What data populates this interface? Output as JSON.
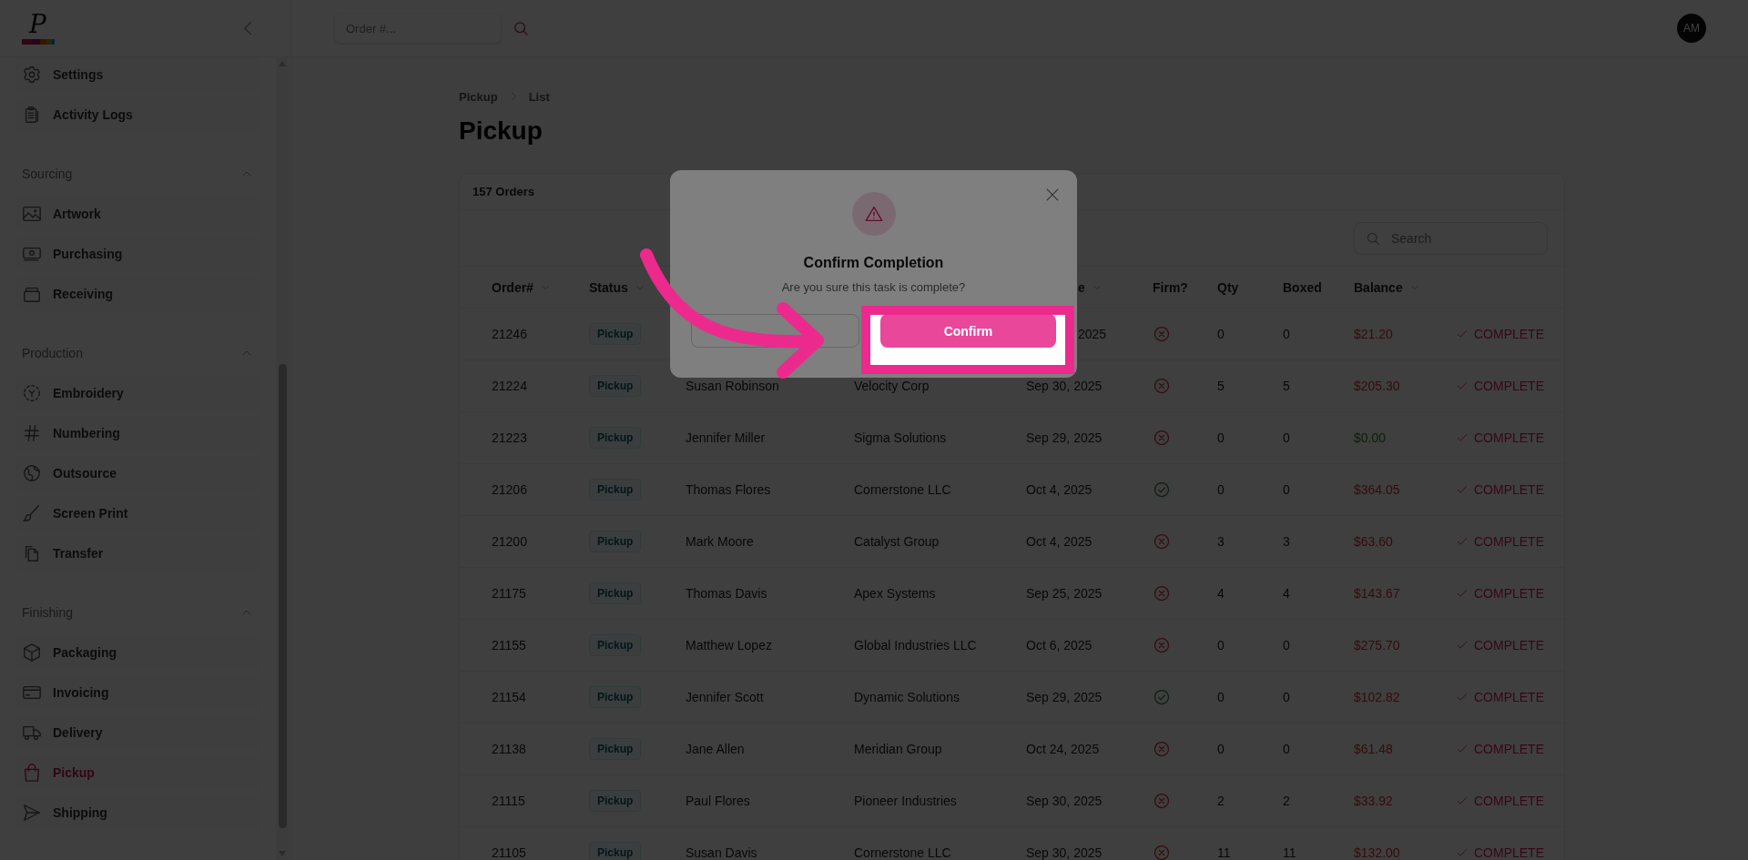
{
  "sidebar": {
    "logo": "P",
    "sections": [
      {
        "items": [
          {
            "label": "Settings",
            "selected": false
          },
          {
            "label": "Activity Logs",
            "selected": false
          }
        ]
      },
      {
        "title": "Sourcing",
        "expanded": true,
        "items": [
          {
            "label": "Artwork",
            "selected": false
          },
          {
            "label": "Purchasing",
            "selected": false
          },
          {
            "label": "Receiving",
            "selected": false
          }
        ]
      },
      {
        "title": "Production",
        "expanded": true,
        "items": [
          {
            "label": "Embroidery",
            "selected": false
          },
          {
            "label": "Numbering",
            "selected": false
          },
          {
            "label": "Outsource",
            "selected": false
          },
          {
            "label": "Screen Print",
            "selected": false
          },
          {
            "label": "Transfer",
            "selected": false
          }
        ]
      },
      {
        "title": "Finishing",
        "expanded": true,
        "items": [
          {
            "label": "Packaging",
            "selected": false
          },
          {
            "label": "Invoicing",
            "selected": false
          },
          {
            "label": "Delivery",
            "selected": false
          },
          {
            "label": "Pickup",
            "selected": true
          },
          {
            "label": "Shipping",
            "selected": false
          }
        ]
      }
    ]
  },
  "topbar": {
    "search": {
      "placeholder": "Order #..."
    },
    "avatar": "AM"
  },
  "breadcrumb": [
    "Pickup",
    "List"
  ],
  "title": "Pickup",
  "orders": {
    "count": "157 Orders",
    "search": {
      "placeholder": "Search"
    },
    "columns": [
      {
        "label": "Order#",
        "sortable": true
      },
      {
        "label": "Status",
        "sortable": true
      },
      {
        "label": "e",
        "sortable": true
      },
      {
        "label": "Firm?",
        "sortable": false
      },
      {
        "label": "Qty",
        "sortable": false
      },
      {
        "label": "Boxed",
        "sortable": false
      },
      {
        "label": "Balance",
        "sortable": true
      }
    ],
    "rows": [
      {
        "order": "21246",
        "status": "Pickup",
        "due": "2025",
        "firm": false,
        "qty": "0",
        "boxed": "0",
        "balance": "$21.20",
        "paid": false,
        "action": "COMPLETE"
      },
      {
        "order": "21224",
        "status": "Pickup",
        "customer": "Susan Robinson",
        "company": "Velocity Corp",
        "due": "Sep 30, 2025",
        "firm": false,
        "qty": "5",
        "boxed": "5",
        "balance": "$205.30",
        "paid": false,
        "action": "COMPLETE"
      },
      {
        "order": "21223",
        "status": "Pickup",
        "customer": "Jennifer Miller",
        "company": "Sigma Solutions",
        "due": "Sep 29, 2025",
        "firm": false,
        "qty": "0",
        "boxed": "0",
        "balance": "$0.00",
        "paid": true,
        "action": "COMPLETE"
      },
      {
        "order": "21206",
        "status": "Pickup",
        "customer": "Thomas Flores",
        "company": "Cornerstone LLC",
        "due": "Oct 4, 2025",
        "firm": true,
        "qty": "0",
        "boxed": "0",
        "balance": "$364.05",
        "paid": false,
        "action": "COMPLETE"
      },
      {
        "order": "21200",
        "status": "Pickup",
        "customer": "Mark Moore",
        "company": "Catalyst Group",
        "due": "Oct 4, 2025",
        "firm": false,
        "qty": "3",
        "boxed": "3",
        "balance": "$63.60",
        "paid": false,
        "action": "COMPLETE"
      },
      {
        "order": "21175",
        "status": "Pickup",
        "customer": "Thomas Davis",
        "company": "Apex Systems",
        "due": "Sep 25, 2025",
        "firm": false,
        "qty": "4",
        "boxed": "4",
        "balance": "$143.67",
        "paid": false,
        "action": "COMPLETE"
      },
      {
        "order": "21155",
        "status": "Pickup",
        "customer": "Matthew Lopez",
        "company": "Global Industries LLC",
        "due": "Oct 6, 2025",
        "firm": false,
        "qty": "0",
        "boxed": "0",
        "balance": "$275.70",
        "paid": false,
        "action": "COMPLETE"
      },
      {
        "order": "21154",
        "status": "Pickup",
        "customer": "Jennifer Scott",
        "company": "Dynamic Solutions",
        "due": "Sep 29, 2025",
        "firm": true,
        "qty": "0",
        "boxed": "0",
        "balance": "$102.82",
        "paid": false,
        "action": "COMPLETE"
      },
      {
        "order": "21138",
        "status": "Pickup",
        "customer": "Jane Allen",
        "company": "Meridian Group",
        "due": "Oct 24, 2025",
        "firm": false,
        "qty": "0",
        "boxed": "0",
        "balance": "$61.48",
        "paid": false,
        "action": "COMPLETE"
      },
      {
        "order": "21115",
        "status": "Pickup",
        "customer": "Paul Flores",
        "company": "Pioneer Industries",
        "due": "Sep 30, 2025",
        "firm": false,
        "qty": "2",
        "boxed": "2",
        "balance": "$33.92",
        "paid": false,
        "action": "COMPLETE"
      },
      {
        "order": "21105",
        "status": "Pickup",
        "customer": "Susan Davis",
        "company": "Cornerstone LLC",
        "due": "Sep 30, 2025",
        "firm": false,
        "qty": "11",
        "boxed": "11",
        "balance": "$132.00",
        "paid": false,
        "action": "COMPLETE"
      }
    ]
  },
  "dialog": {
    "title": "Confirm Completion",
    "message": "Are you sure this task is complete?",
    "confirm": "Confirm"
  }
}
